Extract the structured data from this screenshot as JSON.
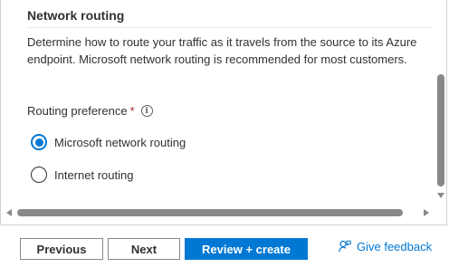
{
  "section": {
    "title": "Network routing",
    "description": "Determine how to route your traffic as it travels from the source to its Azure endpoint. Microsoft network routing is recommended for most customers."
  },
  "routing": {
    "label": "Routing preference",
    "required_marker": "*",
    "info_icon": "info-icon",
    "options": [
      {
        "label": "Microsoft network routing",
        "selected": true
      },
      {
        "label": "Internet routing",
        "selected": false
      }
    ]
  },
  "footer": {
    "previous_label": "Previous",
    "next_label": "Next",
    "review_create_label": "Review + create",
    "feedback_label": "Give feedback",
    "feedback_icon": "feedback-person-icon"
  },
  "colors": {
    "accent": "#0078d4",
    "required": "#a4262c",
    "text": "#323130"
  }
}
